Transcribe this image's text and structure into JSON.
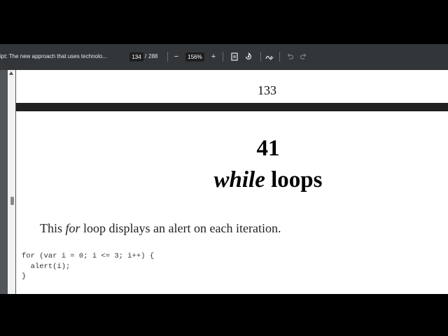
{
  "toolbar": {
    "doc_title": "ipt: The new approach that uses technolo...",
    "current_page": "134",
    "page_separator": "/",
    "total_pages": "288",
    "zoom_out_icon": "minus-icon",
    "zoom_in_icon": "plus-icon",
    "zoom_level": "156%",
    "fit_page_icon": "fit-page-icon",
    "rotate_icon": "rotate-icon",
    "annotate_icon": "annotate-icon",
    "undo_icon": "undo-icon",
    "redo_icon": "redo-icon"
  },
  "page": {
    "page_number": "133",
    "chapter_number": "41",
    "chapter_title_em": "while",
    "chapter_title_rest": " loops",
    "body_pre": "This ",
    "body_em": "for",
    "body_post": " loop displays an alert on each iteration.",
    "code_lines": [
      "for (var i = 0; i <= 3; i++) {",
      "  alert(i);",
      "}"
    ]
  },
  "colors": {
    "toolbar_bg": "#323639",
    "viewer_bg": "#525659",
    "page_bg": "#ffffff",
    "header_rule": "#202020"
  }
}
